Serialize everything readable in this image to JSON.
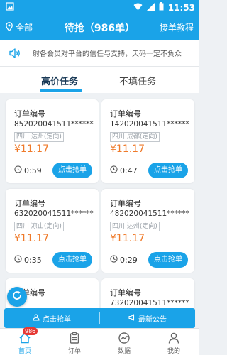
{
  "status_bar": {
    "time": "11:53"
  },
  "app_bar": {
    "location": "全部",
    "title": "待抢（986单）",
    "guide_link": "接单教程"
  },
  "notice": {
    "text": "射各会员对平台的信任与支持，天码一定不负众"
  },
  "tabs": [
    {
      "label": "高价任务",
      "active": true
    },
    {
      "label": "不填任务",
      "active": false
    }
  ],
  "orders": [
    {
      "label": "订单编号",
      "number": "852020041511******",
      "place": "四川 达州(定向)",
      "price": "¥11.17",
      "countdown": "0:59",
      "button": "点击抢单"
    },
    {
      "label": "订单编号",
      "number": "142020041511******",
      "place": "四川 成都(定向)",
      "price": "¥11.17",
      "countdown": "0:47",
      "button": "点击抢单"
    },
    {
      "label": "订单编号",
      "number": "632020041511******",
      "place": "四川 凉山(定向)",
      "price": "¥11.17",
      "countdown": "0:35",
      "button": "点击抢单"
    },
    {
      "label": "订单编号",
      "number": "482020041511******",
      "place": "四川 达州(定向)",
      "price": "¥11.17",
      "countdown": "0:29",
      "button": "点击抢单"
    },
    {
      "label": "订单编号",
      "number": "",
      "place": "",
      "price": "",
      "countdown": "",
      "button": ""
    },
    {
      "label": "订单编号",
      "number": "732020041511******",
      "place": "",
      "price": "",
      "countdown": "",
      "button": ""
    }
  ],
  "action_bar": {
    "grab_label": "点击抢单",
    "announcement_label": "最新公告"
  },
  "bottom_nav": [
    {
      "label": "首页",
      "icon": "home-icon",
      "active": true,
      "badge": "986"
    },
    {
      "label": "订单",
      "icon": "clipboard-icon",
      "active": false
    },
    {
      "label": "数据",
      "icon": "chart-icon",
      "active": false
    },
    {
      "label": "我的",
      "icon": "person-icon",
      "active": false
    }
  ],
  "colors": {
    "primary": "#1aa3e8",
    "price": "#ef7a2a",
    "badge": "#e53935"
  }
}
